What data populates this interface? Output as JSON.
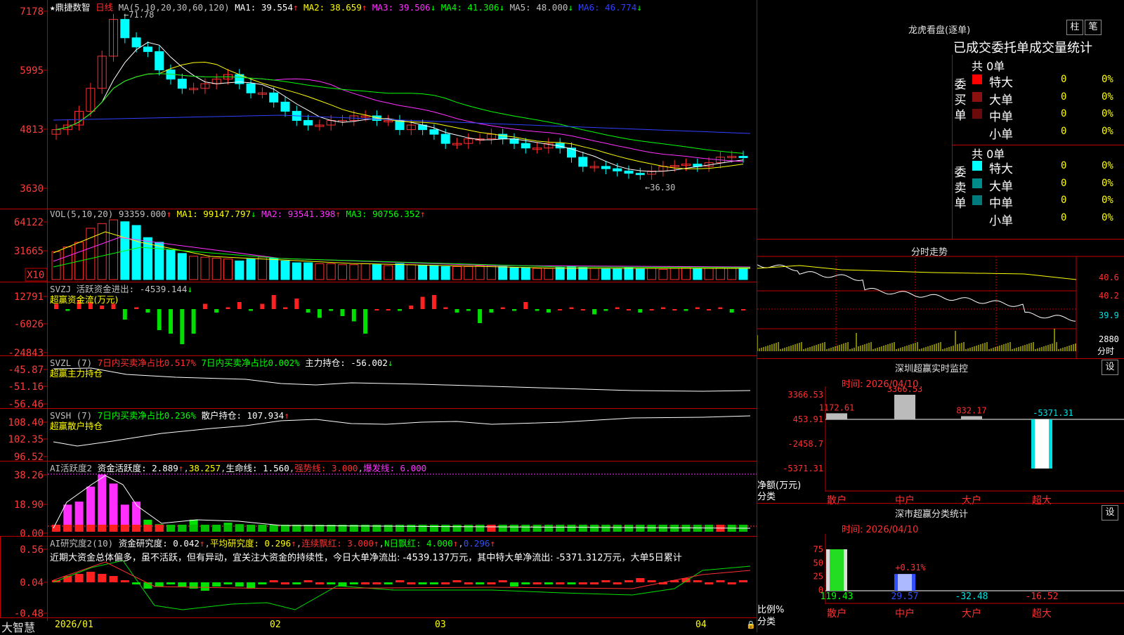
{
  "stock": {
    "name": "鼎捷数智",
    "period": "日线"
  },
  "main": {
    "yticks": [
      "7178",
      "5995",
      "4813",
      "3630"
    ],
    "high_note": "71.78",
    "low_note": "36.30",
    "ma_header": {
      "label": "MA(5,10,20,30,60,120)",
      "items": [
        {
          "text": "MA1: 39.554",
          "arrow": "↑",
          "color": "#ffffff",
          "arrowColor": "#ff3030"
        },
        {
          "text": "MA2: 38.659",
          "arrow": "↑",
          "color": "#ffff00",
          "arrowColor": "#ff3030"
        },
        {
          "text": "MA3: 39.506",
          "arrow": "↓",
          "color": "#ff30ff",
          "arrowColor": "#00ff00"
        },
        {
          "text": "MA4: 41.306",
          "arrow": "↓",
          "color": "#00ff00",
          "arrowColor": "#00ff00"
        },
        {
          "text": "MA5: 48.000",
          "arrow": "↓",
          "color": "#c0c0c0",
          "arrowColor": "#00ff00"
        },
        {
          "text": "MA6: 46.774",
          "arrow": "↓",
          "color": "#3040ff",
          "arrowColor": "#00ff00"
        }
      ]
    }
  },
  "vol": {
    "yticks": [
      "64122",
      "31665"
    ],
    "unit": "X10",
    "header": [
      {
        "text": "VOL(5,10,20)",
        "color": "#c0c0c0"
      },
      {
        "text": "93359.000",
        "color": "#c0c0c0",
        "arrow": "↑",
        "arrowColor": "#ff3030"
      },
      {
        "text": "MA1: 99147.797",
        "color": "#ffff00",
        "arrow": "↓",
        "arrowColor": "#00ff00"
      },
      {
        "text": "MA2: 93541.398",
        "color": "#ff30ff",
        "arrow": "↑",
        "arrowColor": "#ff3030"
      },
      {
        "text": "MA3: 90756.352",
        "color": "#00ff00",
        "arrow": "↑",
        "arrowColor": "#ff3030"
      }
    ]
  },
  "svzj": {
    "yticks": [
      "12791",
      "-6026",
      "-24843"
    ],
    "header": [
      {
        "text": "SVZJ",
        "color": "#c0c0c0"
      },
      {
        "text": "活跃资金进出: -4539.144",
        "color": "#c0c0c0",
        "arrow": "↓",
        "arrowColor": "#00ff00"
      }
    ],
    "subtitle": "超赢资金流(万元)"
  },
  "svzl": {
    "yticks": [
      "-45.87",
      "-51.16",
      "-56.46"
    ],
    "header": [
      {
        "text": "SVZL (7)",
        "color": "#c0c0c0"
      },
      {
        "text": "7日内买卖净占比0.517%",
        "color": "#ff3030"
      },
      {
        "text": "7日内买卖净占比0.002%",
        "color": "#00ff00"
      },
      {
        "text": "主力持仓: -56.002",
        "color": "#ffffff",
        "arrow": "↓",
        "arrowColor": "#00ff00"
      }
    ],
    "subtitle": "超赢主力持仓"
  },
  "svsh": {
    "yticks": [
      "108.40",
      "102.35",
      "96.52"
    ],
    "header": [
      {
        "text": "SVSH (7)",
        "color": "#c0c0c0"
      },
      {
        "text": "7日内买卖净占比0.236%",
        "color": "#00ff00"
      },
      {
        "text": "散户持仓: 107.934",
        "color": "#ffffff",
        "arrow": "↑",
        "arrowColor": "#ff3030"
      }
    ],
    "subtitle": "超赢散户持仓"
  },
  "ai1": {
    "yticks": [
      "38.26",
      "18.90",
      "0.00"
    ],
    "header": [
      {
        "text": "AI活跃度2",
        "color": "#c0c0c0"
      },
      {
        "text": "资金活跃度: 2.889",
        "color": "#ffffff",
        "arrow": "↑",
        "arrowColor": "#ff3030"
      },
      {
        "text": "38.257",
        "color": "#ffff00",
        "prefix": ","
      },
      {
        "text": "生命线: 1.560",
        "color": "#ffffff",
        "prefix": ","
      },
      {
        "text": "强势线: 3.000",
        "color": "#ff3030",
        "prefix": ","
      },
      {
        "text": "爆发线: 6.000",
        "color": "#ff30ff",
        "prefix": ","
      }
    ]
  },
  "ai2": {
    "yticks": [
      "0.56",
      "0.04",
      "-0.48"
    ],
    "header": [
      {
        "text": "AI研究度2(10)",
        "color": "#c0c0c0"
      },
      {
        "text": "资金研究度: 0.042",
        "color": "#ffffff",
        "arrow": "↑",
        "arrowColor": "#ff3030"
      },
      {
        "text": "平均研究度: 0.296",
        "color": "#ffff00",
        "arrow": "↑",
        "arrowColor": "#ff3030",
        "prefix": ","
      },
      {
        "text": "连续飘红: 3.000",
        "color": "#ff3030",
        "arrow": "↑",
        "arrowColor": "#ff3030",
        "prefix": ","
      },
      {
        "text": "N日飘红: 4.000",
        "color": "#00ff00",
        "arrow": "↑",
        "arrowColor": "#ff3030",
        "prefix": ","
      },
      {
        "text": "0.296",
        "color": "#3050ff",
        "arrow": "↑",
        "arrowColor": "#ff3030",
        "prefix": ","
      }
    ],
    "comment": "近期大资金总体偏多，虽不活跃，但有异动，宜关注大资金的持续性，今日大单净流出: -4539.137万元，其中特大单净流出: -5371.312万元，大单5日累计"
  },
  "xaxis": {
    "labels": [
      "2026/01",
      "02",
      "03",
      "04"
    ]
  },
  "brand": "大智慧",
  "lhb": {
    "title": "龙虎看盘(逐单)",
    "btn_bar": "柱",
    "btn_bi": "笔",
    "subtitle": "已成交委托单成交量统计",
    "buy": {
      "side": "委买单",
      "total": "共 0单",
      "rows": [
        {
          "name": "特大",
          "color": "#ff0000",
          "count": "0",
          "pct": "0%"
        },
        {
          "name": "大单",
          "color": "#8b1010",
          "count": "0",
          "pct": "0%"
        },
        {
          "name": "中单",
          "color": "#6a0a0a",
          "count": "0",
          "pct": "0%"
        },
        {
          "name": "小单",
          "color": "#000000",
          "count": "0",
          "pct": "0%"
        }
      ]
    },
    "sell": {
      "side": "委卖单",
      "total": "共 0单",
      "rows": [
        {
          "name": "特大",
          "color": "#00ffff",
          "count": "0",
          "pct": "0%"
        },
        {
          "name": "大单",
          "color": "#008b8b",
          "count": "0",
          "pct": "0%"
        },
        {
          "name": "中单",
          "color": "#007a7a",
          "count": "0",
          "pct": "0%"
        },
        {
          "name": "小单",
          "color": "#000000",
          "count": "0",
          "pct": "0%"
        }
      ]
    }
  },
  "fenshi": {
    "title": "分时走势",
    "prices": [
      "40.6",
      "40.2",
      "39.9"
    ],
    "vol_top": "2880",
    "vol_unit": "分时"
  },
  "sz_monitor": {
    "title": "深圳超赢实时监控",
    "time": "时间: 2026/04/10",
    "btn": "设",
    "yticks": [
      "3366.53",
      "453.91",
      "-2458.7",
      "-5371.31"
    ],
    "axis_label": "净额(万元)",
    "cat_label": "分类",
    "chart_data": {
      "type": "bar",
      "categories": [
        "散户",
        "中户",
        "大户",
        "超大"
      ],
      "values": [
        1172.61,
        3366.53,
        832.17,
        -5371.31
      ],
      "value_labels": [
        "1172.61",
        "3366.53",
        "832.17",
        "-5371.31"
      ],
      "ylim": [
        -5371.31,
        3366.53
      ]
    }
  },
  "sz_class": {
    "title": "深市超赢分类统计",
    "time": "时间: 2026/04/10",
    "btn": "设",
    "yticks": [
      "75",
      "50",
      "25",
      "0"
    ],
    "axis_label": "比例%",
    "cat_label": "分类",
    "bar_note": "+0.31%",
    "chart_data": {
      "type": "bar",
      "categories": [
        "散户",
        "中户",
        "大户",
        "超大"
      ],
      "values": [
        119.43,
        29.57,
        -32.48,
        -16.52
      ],
      "value_labels": [
        "119.43",
        "29.57",
        "-32.48",
        "-16.52"
      ],
      "ylim": [
        0,
        75
      ]
    }
  }
}
